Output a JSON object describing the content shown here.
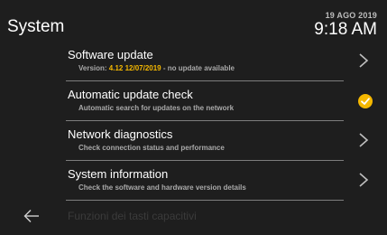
{
  "header": {
    "title": "System",
    "date": "19 AGO 2019",
    "time": "9:18 AM"
  },
  "menu": {
    "software_update": {
      "label": "Software update",
      "sub_prefix": "Version: ",
      "sub_version": "4.12 12/07/2019",
      "sub_suffix": " - no update available"
    },
    "auto_update_check": {
      "label": "Automatic update check",
      "sub": "Automatic search for updates on the network",
      "enabled": true
    },
    "network_diagnostics": {
      "label": "Network diagnostics",
      "sub": "Check connection status and performance"
    },
    "system_information": {
      "label": "System information",
      "sub": "Check the software and hardware version details"
    },
    "hidden_item": {
      "label": "Funzioni dei tasti capacitivi"
    }
  },
  "colors": {
    "accent": "#f5b800",
    "background": "#1e1e1e"
  },
  "icons": {
    "back": "arrow-left-icon",
    "chevron": "chevron-right-icon",
    "check": "check-circle-icon"
  }
}
